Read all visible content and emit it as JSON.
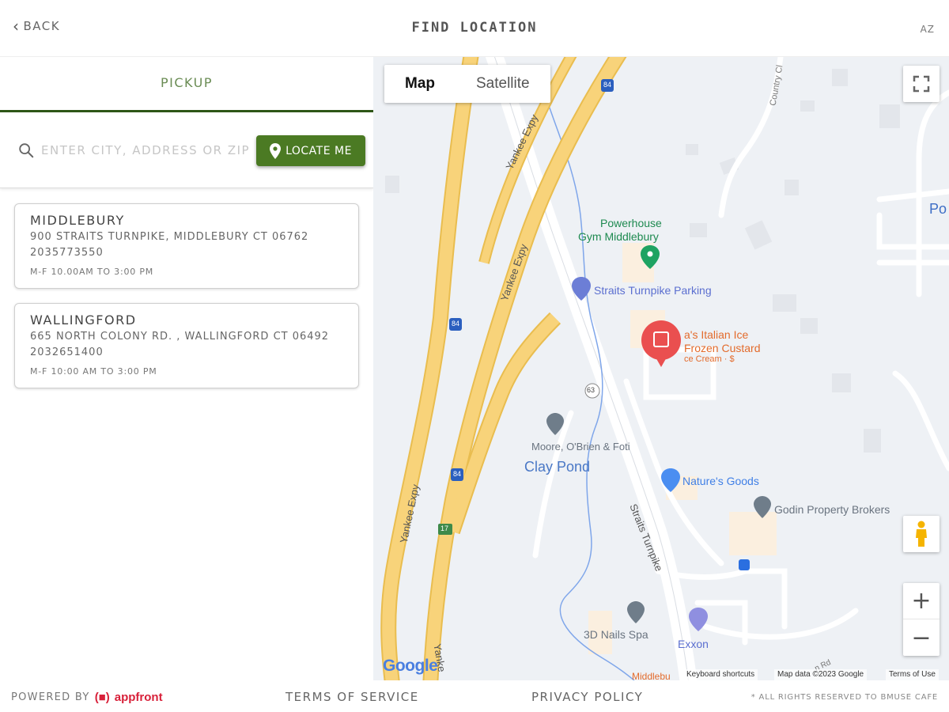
{
  "header": {
    "back_label": "BACK",
    "title": "FIND LOCATION",
    "lang": "AZ"
  },
  "panel": {
    "tab_label": "PICKUP",
    "search": {
      "placeholder": "ENTER CITY, ADDRESS OR ZIP",
      "value": ""
    },
    "locate_label": "LOCATE ME",
    "locations": [
      {
        "name": "MIDDLEBURY",
        "address": "900 STRAITS TURNPIKE, MIDDLEBURY CT 06762",
        "phone": "2035773550",
        "hours": "M-F 10.00AM TO 3:00 PM"
      },
      {
        "name": "WALLINGFORD",
        "address": "665 NORTH COLONY RD. , WALLINGFORD CT 06492",
        "phone": "2032651400",
        "hours": "M-F 10:00 AM TO 3:00 PM"
      }
    ]
  },
  "map": {
    "maptype_map": "Map",
    "maptype_satellite": "Satellite",
    "labels": {
      "powerhouse_1": "Powerhouse",
      "powerhouse_2": "Gym Middlebury",
      "parking": "Straits Turnpike Parking",
      "italian_ice_1": "a's Italian Ice",
      "italian_ice_2": "Frozen Custard",
      "italian_ice_3": "ce Cream · $",
      "moore": "Moore, O'Brien & Foti",
      "clay_pond": "Clay Pond",
      "natures_goods": "Nature's Goods",
      "godin": "Godin Property Brokers",
      "nails": "3D Nails Spa",
      "exxon": "Exxon",
      "yankee_1": "Yankee Expy",
      "yankee_2": "Yankee Expy",
      "yankee_3": "Yankee Expy",
      "yankee_4": "Yanke",
      "straits": "Straits Turnpike",
      "country_club": "Country Cl",
      "po": "Po",
      "middlebury": "Middlebu",
      "rd": "n Rd",
      "shield_84": "84",
      "shield_63": "63",
      "shield_17": "17"
    },
    "google_logo": "Google",
    "keyboard": "Keyboard shortcuts",
    "map_data": "Map data ©2023 Google",
    "terms": "Terms of Use",
    "zoom_in": "+",
    "zoom_out": "−"
  },
  "colors": {
    "accent": "#4b7a23",
    "tab_underline": "#2e5617",
    "brand": "#d8213a",
    "highway": "#f6cf6e",
    "water": "#6f9de6"
  },
  "footer": {
    "powered_by": "POWERED BY",
    "brand_mark": "(■)",
    "brand_name": "appfront",
    "terms": "TERMS OF SERVICE",
    "privacy": "PRIVACY POLICY",
    "rights": "* ALL RIGHTS RESERVED TO BMUSE CAFE"
  }
}
